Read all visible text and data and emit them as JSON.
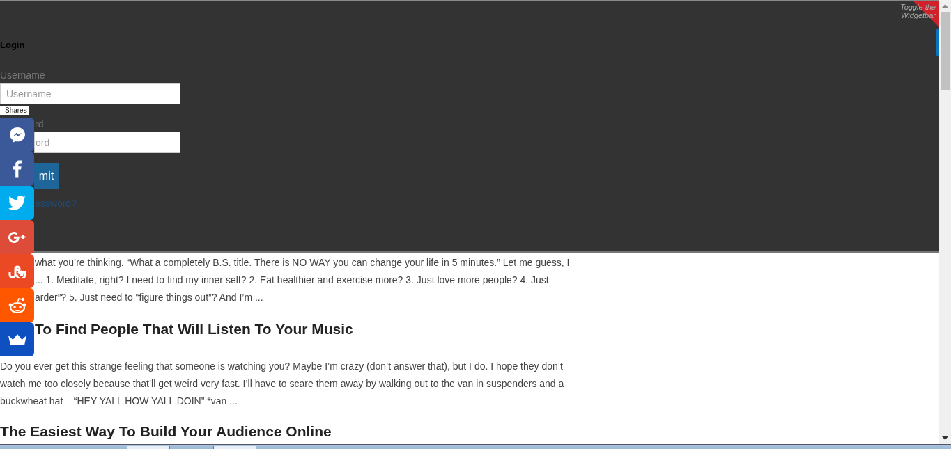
{
  "widgetbar": {
    "toggle": "Toggle the Widgetbar"
  },
  "login": {
    "title": "Login",
    "username_label": "Username",
    "username_placeholder": "Username",
    "password_label": "rd",
    "password_placeholder": "ord",
    "submit": "mit",
    "forgot_link": "assword?"
  },
  "share_bar": {
    "label": "Shares",
    "buttons": [
      {
        "kind": "messenger"
      },
      {
        "kind": "facebook"
      },
      {
        "kind": "twitter"
      },
      {
        "kind": "googleplus"
      },
      {
        "kind": "stumbleupon"
      },
      {
        "kind": "reddit"
      },
      {
        "kind": "crown"
      }
    ]
  },
  "posts": [
    {
      "excerpt_lines": [
        "what you’re thinking. “What a completely B.S. title. There is NO WAY you can change your life in 5 minutes.” Let me guess, I",
        "... 1. Meditate, right? I need to find my inner self?  2. Eat healthier and exercise more? 3. Just love more people?  4. Just",
        "arder”? 5. Just need to “figure things out”? And I’m ..."
      ]
    },
    {
      "title": "To Find People That Will Listen To Your Music",
      "excerpt_lines": [
        "Do you ever get this strange feeling that someone is watching you? Maybe I’m crazy (don’t answer that), but I do. I hope they don’t",
        "watch me too closely because that’ll get weird very fast. I’ll have to scare them away by walking out to the van in suspenders and a",
        "buckwheat hat –  “HEY YALL HOW YALL DOIN” *van ..."
      ]
    },
    {
      "title": "The Easiest Way To Build Your Audience Online"
    }
  ]
}
